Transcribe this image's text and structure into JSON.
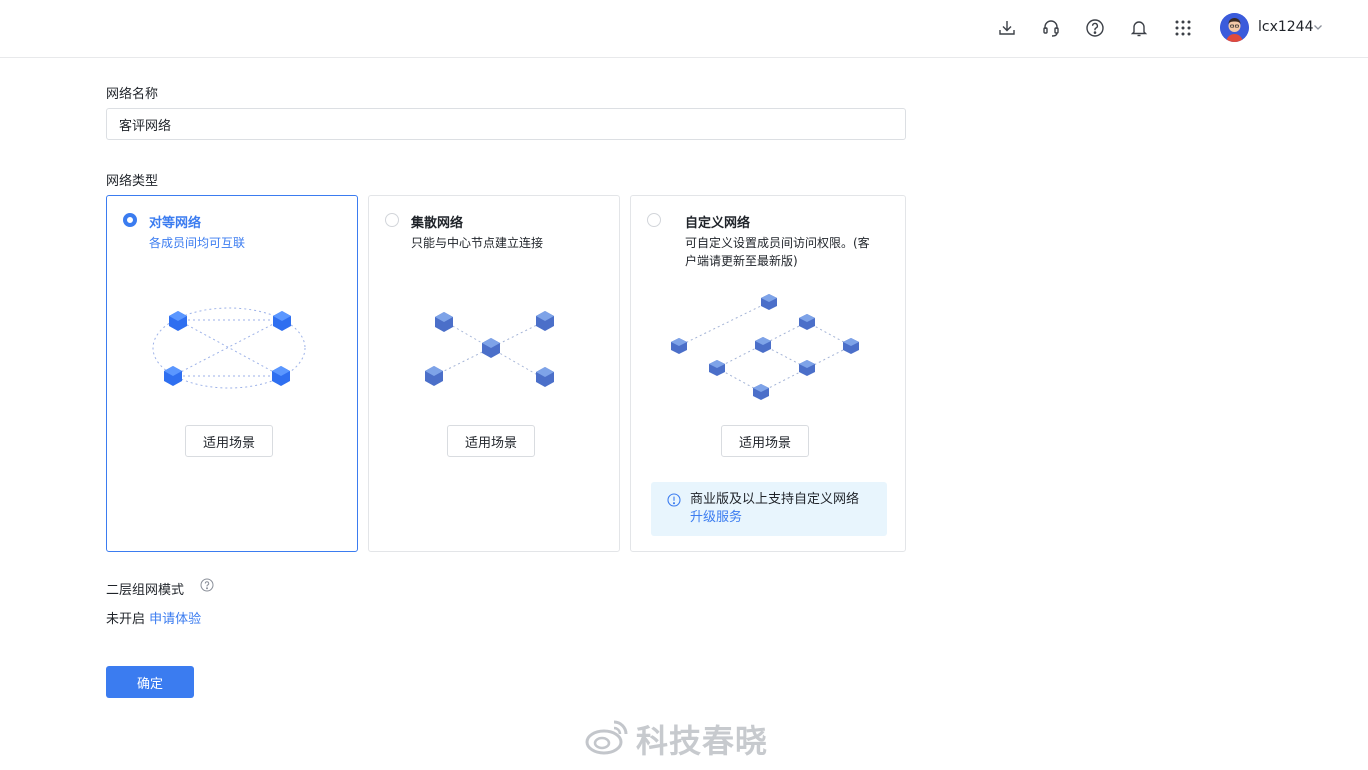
{
  "header": {
    "icons": [
      "download-icon",
      "headset-icon",
      "help-icon",
      "bell-icon",
      "apps-grid-icon"
    ],
    "username": "lcx1244"
  },
  "form": {
    "name_label": "网络名称",
    "name_value": "客评网络",
    "type_label": "网络类型",
    "network_types": [
      {
        "title": "对等网络",
        "desc": "各成员间均可互联",
        "button": "适用场景",
        "selected": true
      },
      {
        "title": "集散网络",
        "desc": "只能与中心节点建立连接",
        "button": "适用场景",
        "selected": false
      },
      {
        "title": "自定义网络",
        "desc": "可自定义设置成员间访问权限。(客户端请更新至最新版)",
        "button": "适用场景",
        "selected": false
      }
    ],
    "notice": {
      "text": "商业版及以上支持自定义网络",
      "link": "升级服务"
    },
    "layer2_label": "二层组网模式",
    "layer2_status": "未开启",
    "layer2_link": "申请体验",
    "confirm": "确定"
  },
  "watermark": "科技春晓",
  "colors": {
    "accent": "#3b7cf0",
    "notice_bg": "#e8f5fd",
    "border": "#e3e5e8"
  }
}
